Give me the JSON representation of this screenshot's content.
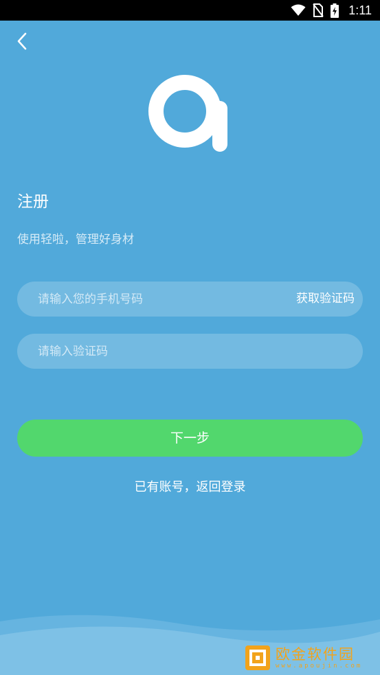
{
  "status_bar": {
    "time": "1:11",
    "icons": [
      "wifi-icon",
      "no-sim-icon",
      "battery-charging-icon"
    ]
  },
  "header": {
    "back_icon": "chevron-left-icon"
  },
  "page": {
    "title": "注册",
    "subtitle": "使用轻啦，管理好身材"
  },
  "form": {
    "phone_placeholder": "请输入您的手机号码",
    "phone_value": "",
    "get_code_label": "获取验证码",
    "code_placeholder": "请输入验证码",
    "code_value": "",
    "next_label": "下一步",
    "login_link": "已有账号，返回登录"
  },
  "watermark": {
    "text": "欧金软件园",
    "sub": "www.apoujin.com"
  },
  "colors": {
    "background": "#51a9da",
    "primary_button": "#52d76d",
    "watermark": "#f2a31b"
  }
}
